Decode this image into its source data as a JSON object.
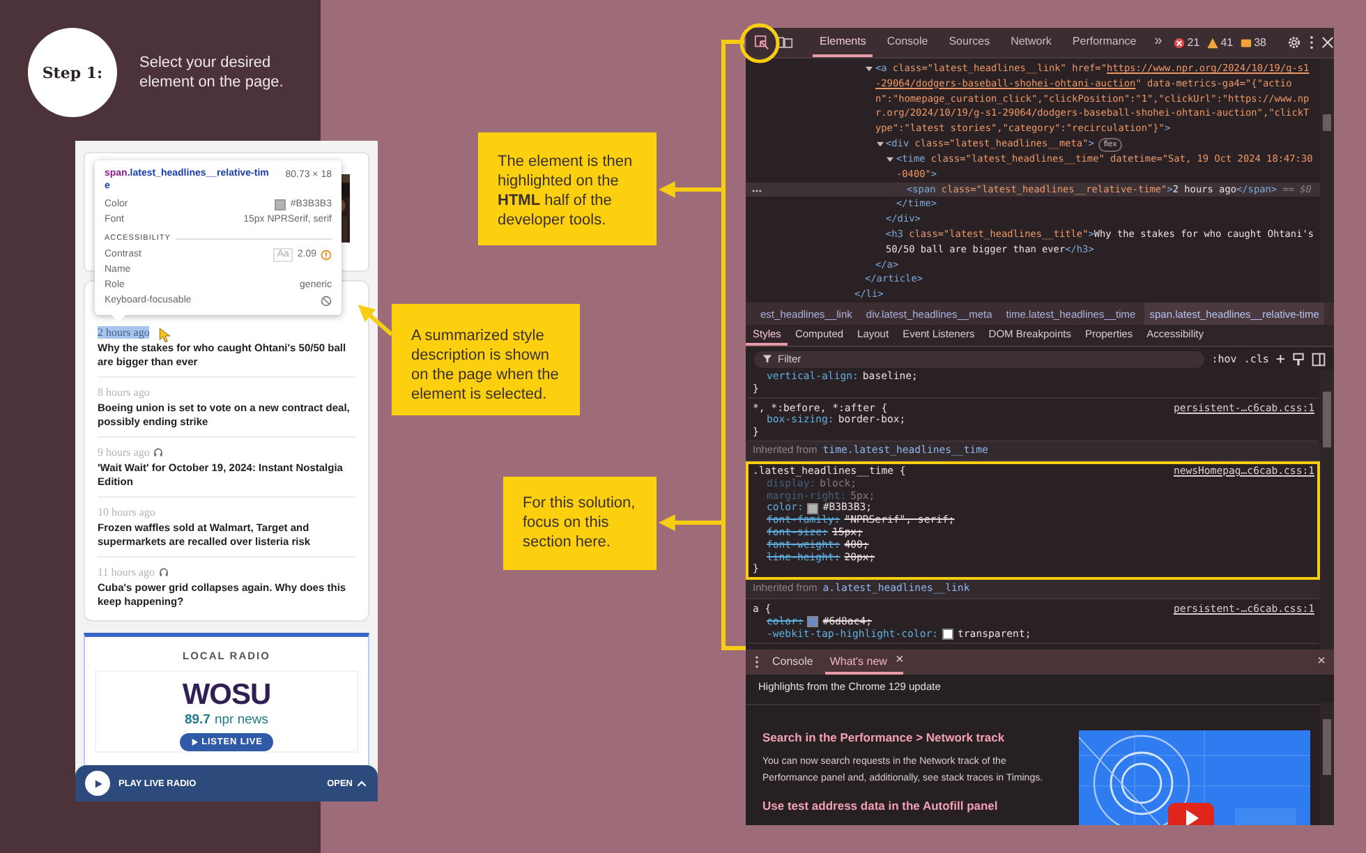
{
  "step": {
    "badge": "Step 1:",
    "instruction": "Select your desired element on the page."
  },
  "phone": {
    "tooltip": {
      "tag": "span",
      "class": ".latest_headlines__relative-time",
      "size": "80.73 × 18",
      "rows": [
        {
          "label": "Color",
          "value": "#B3B3B3",
          "color": "#b3b3b3"
        },
        {
          "label": "Font",
          "value": "15px NPRSerif, serif"
        }
      ],
      "section": "ACCESSIBILITY",
      "a11y": [
        {
          "label": "Contrast",
          "kind": "contrast",
          "sample": "Aa",
          "value": "2.09"
        },
        {
          "label": "Name",
          "kind": "plain"
        },
        {
          "label": "Role",
          "kind": "plain",
          "value": "generic"
        },
        {
          "label": "Keyboard-focusable",
          "kind": "blocked"
        }
      ]
    },
    "headlines": [
      {
        "time": "2 hours ago",
        "audio": false,
        "highlighted": true,
        "title": "Why the stakes for who caught Ohtani's 50/50 ball are bigger than ever"
      },
      {
        "time": "8 hours ago",
        "audio": false,
        "highlighted": false,
        "title": "Boeing union is set to vote on a new contract deal, possibly ending strike"
      },
      {
        "time": "9 hours ago",
        "audio": true,
        "highlighted": false,
        "title": "'Wait Wait' for October 19, 2024: Instant Nostalgia Edition"
      },
      {
        "time": "10 hours ago",
        "audio": false,
        "highlighted": false,
        "title": "Frozen waffles sold at Walmart, Target and supermarkets are recalled over listeria risk"
      },
      {
        "time": "11 hours ago",
        "audio": true,
        "highlighted": false,
        "title": "Cuba's power grid collapses again. Why does this keep happening?"
      }
    ],
    "radio": {
      "heading": "LOCAL RADIO",
      "logo": "WOSU",
      "frequency": "89.7",
      "network": "npr news",
      "button": "LISTEN LIVE"
    },
    "player": {
      "label": "PLAY LIVE RADIO",
      "open": "OPEN"
    }
  },
  "callouts": [
    {
      "text": "The element is then highlighted on the **HTML** half of the developer tools."
    },
    {
      "text": "A summarized style description is shown on the page when the element is selected."
    },
    {
      "text": "For this solution, focus on this section here."
    }
  ],
  "devtools": {
    "tabs": [
      {
        "label": "Elements",
        "selected": true
      },
      {
        "label": "Console",
        "selected": false
      },
      {
        "label": "Sources",
        "selected": false
      },
      {
        "label": "Network",
        "selected": false
      },
      {
        "label": "Performance",
        "selected": false
      }
    ],
    "more_tabs": "»",
    "errors": "21",
    "warnings": "41",
    "issues": "38",
    "dom": [
      {
        "close": [
          {
            "kind": "tag",
            "text": "</li>"
          }
        ],
        "children": [
          {
            "close": [
              {
                "kind": "tag",
                "text": "</article>"
              }
            ],
            "children": [
              {
                "expanded": true,
                "open": [
                  {
                    "kind": "tag",
                    "text": "<a"
                  },
                  {
                    "kind": "attr",
                    "text": " class="
                  },
                  {
                    "kind": "value",
                    "text": "\"latest_headlines__link\""
                  },
                  {
                    "kind": "attr",
                    "text": " href="
                  },
                  {
                    "kind": "value",
                    "text": "\""
                  },
                  {
                    "kind": "link",
                    "text": "https://www.npr.org/2024/10/19/g-s1-29064/dodgers-baseball-shohei-ohtani-auction"
                  },
                  {
                    "kind": "value",
                    "text": "\""
                  },
                  {
                    "kind": "attr",
                    "text": " data-metrics-ga4="
                  },
                  {
                    "kind": "value",
                    "text": "\"{\"action\":\"homepage_curation_click\",\"clickPosition\":\"1\",\"clickUrl\":\"https://www.npr.org/2024/10/19/g-s1-29064/dodgers-baseball-shohei-ohtani-auction\",\"clickType\":\"latest stories\",\"category\":\"recirculation\"}\""
                  },
                  {
                    "kind": "tag",
                    "text": ">"
                  }
                ],
                "close": [
                  {
                    "kind": "tag",
                    "text": "</a>"
                  }
                ],
                "children": [
                  {
                    "expanded": true,
                    "badge": "flex",
                    "open": [
                      {
                        "kind": "tag",
                        "text": "<div"
                      },
                      {
                        "kind": "attr",
                        "text": " class="
                      },
                      {
                        "kind": "value",
                        "text": "\"latest_headlines__meta\""
                      },
                      {
                        "kind": "tag",
                        "text": ">"
                      }
                    ],
                    "close": [
                      {
                        "kind": "tag",
                        "text": "</div>"
                      }
                    ],
                    "children": [
                      {
                        "expanded": true,
                        "open": [
                          {
                            "kind": "tag",
                            "text": "<time"
                          },
                          {
                            "kind": "attr",
                            "text": " class="
                          },
                          {
                            "kind": "value",
                            "text": "\"latest_headlines__time\""
                          },
                          {
                            "kind": "attr",
                            "text": " datetime="
                          },
                          {
                            "kind": "value",
                            "text": "\"Sat, 19 Oct 2024 18:47:30 -0400\""
                          },
                          {
                            "kind": "tag",
                            "text": ">"
                          }
                        ],
                        "close": [
                          {
                            "kind": "tag",
                            "text": "</time>"
                          }
                        ],
                        "children": [
                          {
                            "selected": true,
                            "open": [
                              {
                                "kind": "tag",
                                "text": "<span"
                              },
                              {
                                "kind": "attr",
                                "text": " class="
                              },
                              {
                                "kind": "value",
                                "text": "\"latest_headlines__relative-time\""
                              },
                              {
                                "kind": "tag",
                                "text": ">"
                              },
                              {
                                "kind": "text",
                                "text": "2 hours ago"
                              },
                              {
                                "kind": "tag",
                                "text": "</span>"
                              },
                              {
                                "kind": "hint",
                                "text": " == $0"
                              }
                            ]
                          }
                        ]
                      }
                    ]
                  },
                  {
                    "selected": false,
                    "open": [
                      {
                        "kind": "tag",
                        "text": "<h3"
                      },
                      {
                        "kind": "attr",
                        "text": " class="
                      },
                      {
                        "kind": "value",
                        "text": "\"latest_headlines__title\""
                      },
                      {
                        "kind": "tag",
                        "text": ">"
                      },
                      {
                        "kind": "text",
                        "text": "Why the stakes for who caught Ohtani's 50/50 ball are bigger than ever"
                      },
                      {
                        "kind": "tag",
                        "text": "</h3>"
                      }
                    ]
                  }
                ]
              }
            ]
          }
        ]
      }
    ],
    "breadcrumbs": [
      {
        "label": "est_headlines__link",
        "selected": false
      },
      {
        "label": "div.latest_headlines__meta",
        "selected": false
      },
      {
        "label": "time.latest_headlines__time",
        "selected": false
      },
      {
        "label": "span.latest_headlines__relative-time",
        "selected": true
      }
    ],
    "style_tabs": [
      {
        "label": "Styles",
        "selected": true
      },
      {
        "label": "Computed",
        "selected": false
      },
      {
        "label": "Layout",
        "selected": false
      },
      {
        "label": "Event Listeners",
        "selected": false
      },
      {
        "label": "DOM Breakpoints",
        "selected": false
      },
      {
        "label": "Properties",
        "selected": false
      },
      {
        "label": "Accessibility",
        "selected": false
      }
    ],
    "filter": {
      "placeholder": "Filter"
    },
    "toggles": [
      ":hov",
      ".cls"
    ],
    "add": "+",
    "styles": [
      {
        "kind": "rule",
        "highlighted": false,
        "props": [
          {
            "name": "vertical-align:",
            "value": "baseline;",
            "inactive": false,
            "overridden": false
          }
        ],
        "end": "}"
      },
      {
        "kind": "rule",
        "highlighted": false,
        "selector": "*, *:before, *:after {",
        "source": "persistent-…c6cab.css:1",
        "props": [
          {
            "name": "box-sizing:",
            "value": "border-box;",
            "inactive": false,
            "overridden": false
          }
        ],
        "end": "}"
      },
      {
        "kind": "inherited",
        "label": "Inherited from",
        "selector": "time.latest_headlines__time"
      },
      {
        "kind": "rule",
        "highlighted": true,
        "selector": ".latest_headlines__time {",
        "source": "newsHomepag…c6cab.css:1",
        "props": [
          {
            "name": "display:",
            "value": "block;",
            "inactive": true,
            "overridden": false
          },
          {
            "name": "margin-right:",
            "value": "5px;",
            "inactive": true,
            "overridden": false
          },
          {
            "name": "color:",
            "value": "#B3B3B3;",
            "inactive": false,
            "overridden": false,
            "color": "#b3b3b3"
          },
          {
            "name": "font-family:",
            "value": "\"NPRSerif\", serif;",
            "inactive": false,
            "overridden": true
          },
          {
            "name": "font-size:",
            "value": "15px;",
            "inactive": false,
            "overridden": true
          },
          {
            "name": "font-weight:",
            "value": "400;",
            "inactive": false,
            "overridden": true
          },
          {
            "name": "line-height:",
            "value": "20px;",
            "inactive": false,
            "overridden": true
          }
        ],
        "end": "}"
      },
      {
        "kind": "inherited",
        "label": "Inherited from",
        "selector": "a.latest_headlines__link"
      },
      {
        "kind": "rule",
        "highlighted": false,
        "selector": "a {",
        "source": "persistent-…c6cab.css:1",
        "props": [
          {
            "name": "color:",
            "value": "#6d8ac4;",
            "inactive": false,
            "overridden": true,
            "color": "#6d8ac4"
          },
          {
            "name": "-webkit-tap-highlight-color:",
            "value": "transparent;",
            "inactive": false,
            "overridden": false,
            "color": "#ffffff"
          }
        ]
      }
    ],
    "drawer_tabs": [
      {
        "label": "Console",
        "selected": false,
        "closable": false
      },
      {
        "label": "What's new",
        "selected": true,
        "closable": true
      }
    ],
    "close_glyph": "×",
    "whats_new": {
      "header": "Highlights from the Chrome 129 update",
      "items": [
        {
          "title": "Search in the Performance > Network track",
          "body": "You can now search requests in the Network track of the Performance panel and, additionally, see stack traces in Timings."
        },
        {
          "title": "Use test address data in the Autofill panel"
        }
      ]
    }
  }
}
